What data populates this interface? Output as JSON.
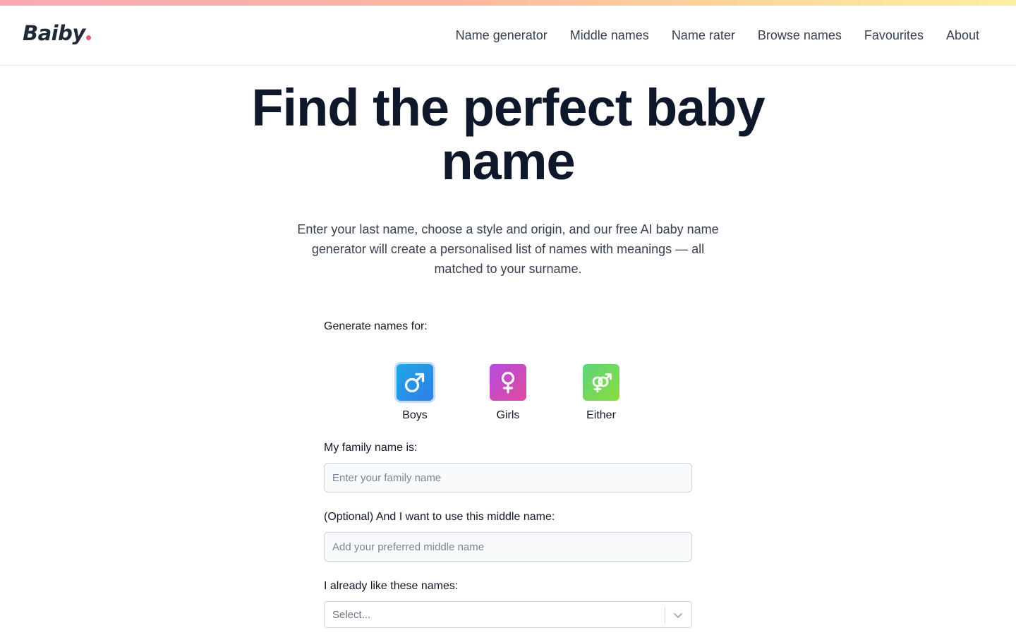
{
  "header": {
    "logo": "Baiby",
    "nav": [
      "Name generator",
      "Middle names",
      "Name rater",
      "Browse names",
      "Favourites",
      "About"
    ]
  },
  "hero": {
    "title_line1": "Find the perfect baby",
    "title_line2": "name",
    "subtitle": "Enter your last name, choose a style and origin, and our free AI baby name generator will create a personalised list of names with meanings — all matched to your surname."
  },
  "form": {
    "generate_for_label": "Generate names for:",
    "genders": [
      {
        "label": "Boys",
        "icon": "male-symbol-icon",
        "selected": true
      },
      {
        "label": "Girls",
        "icon": "female-symbol-icon",
        "selected": false
      },
      {
        "label": "Either",
        "icon": "male-female-symbol-icon",
        "selected": false
      }
    ],
    "family_name": {
      "label": "My family name is:",
      "placeholder": "Enter your family name",
      "value": ""
    },
    "middle_name": {
      "label": "(Optional) And I want to use this middle name:",
      "placeholder": "Add your preferred middle name",
      "value": ""
    },
    "liked_names": {
      "label": "I already like these names:",
      "placeholder": "Select..."
    }
  },
  "colors": {
    "boys": "#2f7fe6",
    "girls": "#c44bc4",
    "either": "#6fd65a",
    "logo_dot": "#e85a7a",
    "title": "#0f172a"
  }
}
